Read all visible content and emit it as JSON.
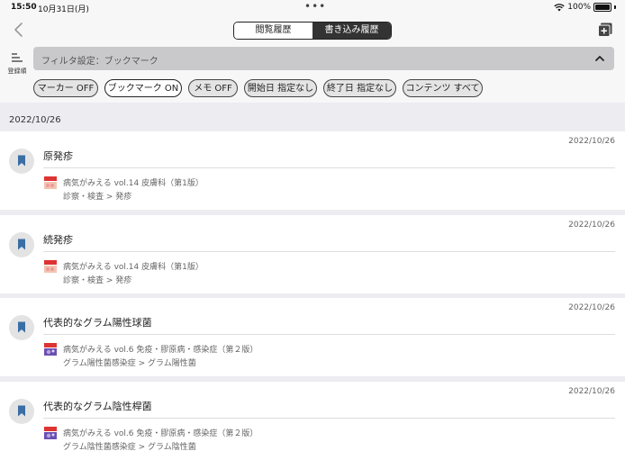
{
  "status_bar": {
    "time": "15:50",
    "date": "10月31日(月)",
    "battery": "100%",
    "battery_level": 1.0
  },
  "nav": {
    "tabs": [
      {
        "label": "閲覧履歴",
        "active": false
      },
      {
        "label": "書き込み履歴",
        "active": true
      }
    ],
    "back_icon": "chevron-left-icon",
    "add_icon": "plus-square-icon"
  },
  "filter": {
    "sort_label": "登録順",
    "setting_label": "フィルタ設定：ブックマーク",
    "chips": [
      {
        "label": "マーカー OFF",
        "active": false
      },
      {
        "label": "ブックマーク ON",
        "active": true
      },
      {
        "label": "メモ OFF",
        "active": false
      },
      {
        "label": "開始日 指定なし",
        "active": false
      },
      {
        "label": "終了日 指定なし",
        "active": false
      },
      {
        "label": "コンテンツ すべて",
        "active": false
      }
    ]
  },
  "section_date": "2022/10/26",
  "items": [
    {
      "date": "2022/10/26",
      "title": "原発疹",
      "book": "病気がみえる vol.14 皮膚科（第1版）",
      "path": "診察・検査 > 発疹"
    },
    {
      "date": "2022/10/26",
      "title": "続発疹",
      "book": "病気がみえる vol.14 皮膚科（第1版）",
      "path": "診察・検査 > 発疹"
    },
    {
      "date": "2022/10/26",
      "title": "代表的なグラム陽性球菌",
      "book": "病気がみえる vol.6 免疫・膠原病・感染症（第２版）",
      "path": "グラム陽性菌感染症 > グラム陽性菌"
    },
    {
      "date": "2022/10/26",
      "title": "代表的なグラム陰性桿菌",
      "book": "病気がみえる vol.6 免疫・膠原病・感染症（第２版）",
      "path": "グラム陰性菌感染症 > グラム陰性菌"
    }
  ],
  "colors": {
    "accent": "#3a6ea5",
    "segment_active": "#333333"
  }
}
